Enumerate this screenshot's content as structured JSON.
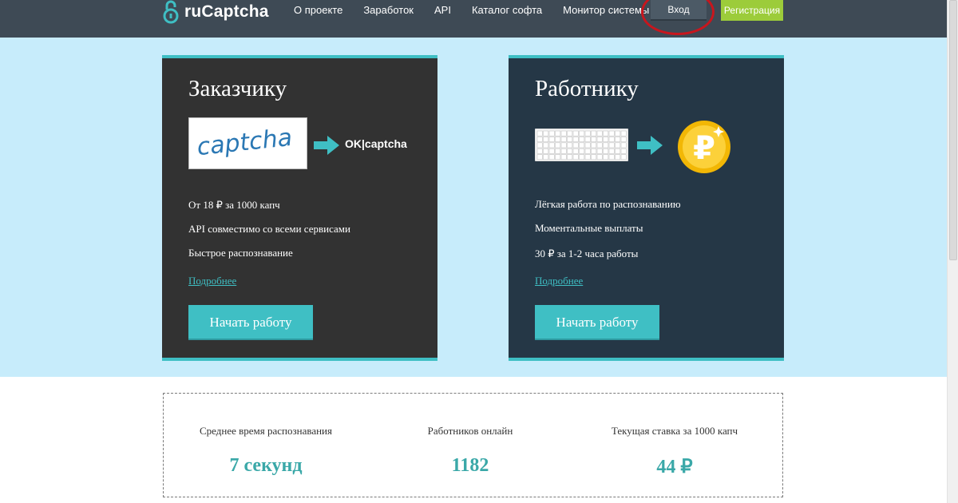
{
  "header": {
    "logo_text": "ruCaptcha",
    "nav": [
      "О проекте",
      "Заработок",
      "API",
      "Каталог софта",
      "Монитор системы"
    ],
    "login_label": "Вход",
    "register_label": "Регистрация",
    "accent_color": "#3fbfc4"
  },
  "customer_card": {
    "title": "Заказчику",
    "captcha_text": "captcha",
    "result_text": "OK|captcha",
    "features": [
      "От 18 ₽ за 1000 капч",
      "API совместимо со всеми сервисами",
      "Быстрое распознавание"
    ],
    "more_label": "Подробнее",
    "button_label": "Начать работу"
  },
  "worker_card": {
    "title": "Работнику",
    "coin_symbol": "₽",
    "features": [
      "Лёгкая работа по распознаванию",
      "Моментальные выплаты",
      "30 ₽ за 1-2 часа работы"
    ],
    "more_label": "Подробнее",
    "button_label": "Начать работу"
  },
  "stats": [
    {
      "label": "Среднее время распознавания",
      "value": "7 секунд"
    },
    {
      "label": "Работников онлайн",
      "value": "1182"
    },
    {
      "label": "Текущая ставка за 1000 капч",
      "value": "44 ₽"
    }
  ]
}
